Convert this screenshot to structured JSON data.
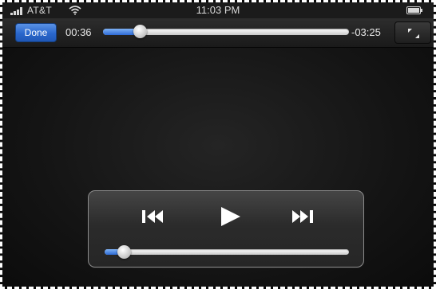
{
  "status_bar": {
    "carrier": "AT&T",
    "time": "11:03 PM",
    "signal_icon": "signal-bars-icon",
    "wifi_icon": "wifi-icon",
    "battery_icon": "battery-icon"
  },
  "top_bar": {
    "done_label": "Done",
    "elapsed": "00:36",
    "remaining": "-03:25",
    "progress_fraction": 0.15,
    "fullscreen_icon": "fullscreen-toggle-icon"
  },
  "transport": {
    "previous_icon": "skip-back-icon",
    "play_icon": "play-icon",
    "next_icon": "skip-forward-icon",
    "volume_fraction": 0.08
  },
  "colors": {
    "accent_blue": "#2a67cc",
    "background": "#0c0c0c",
    "text": "#e8e8e8"
  }
}
